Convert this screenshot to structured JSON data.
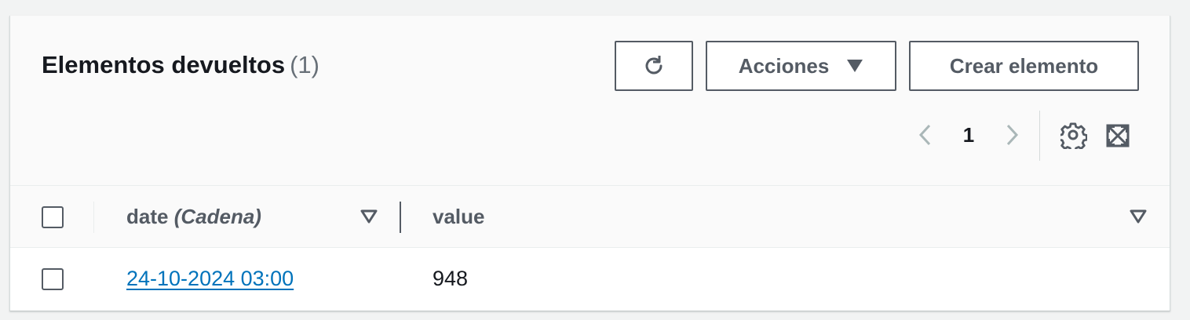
{
  "panel": {
    "title": "Elementos devueltos",
    "count": "(1)"
  },
  "toolbar": {
    "refresh_icon": "refresh-icon",
    "actions_label": "Acciones",
    "create_label": "Crear elemento"
  },
  "pagination": {
    "current_page": "1",
    "prev_icon": "chevron-left-icon",
    "next_icon": "chevron-right-icon"
  },
  "table": {
    "columns": [
      {
        "name": "date",
        "type": "(Cadena)"
      },
      {
        "name": "value"
      }
    ],
    "rows": [
      {
        "date": "24-10-2024 03:00",
        "value": "948"
      }
    ]
  },
  "colors": {
    "link": "#0073bb",
    "button_border": "#545b64",
    "background": "#f2f3f3"
  }
}
